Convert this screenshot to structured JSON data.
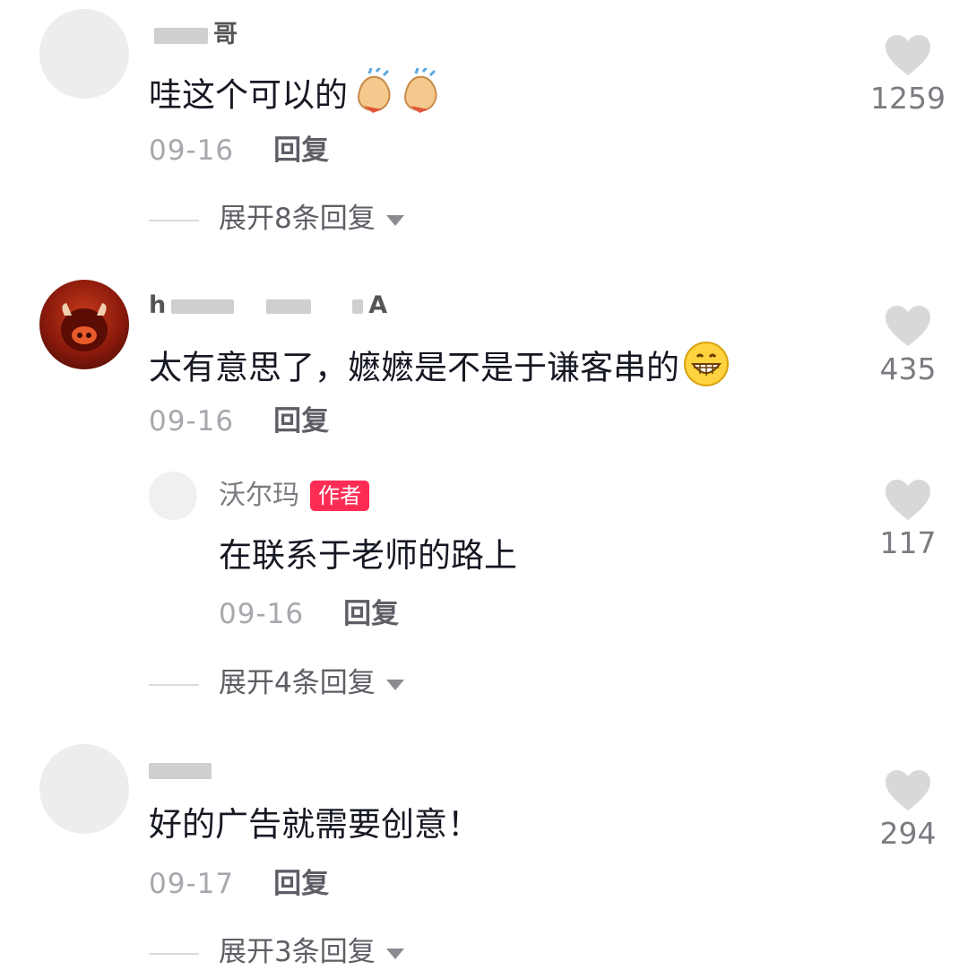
{
  "comments": [
    {
      "username_visible": "哥",
      "text": "哇这个可以的",
      "emoji": "clapping-hands",
      "date": "09-16",
      "reply_label": "回复",
      "likes": "1259",
      "expand_label": "展开8条回复"
    },
    {
      "username_visible": "A",
      "text": "太有意思了，嬷嬷是不是于谦客串的",
      "emoji": "grinning-face",
      "date": "09-16",
      "reply_label": "回复",
      "likes": "435",
      "reply": {
        "username": "沃尔玛",
        "badge": "作者",
        "text": "在联系于老师的路上",
        "date": "09-16",
        "reply_label": "回复",
        "likes": "117"
      },
      "expand_label": "展开4条回复"
    },
    {
      "username_visible": "",
      "text": "好的广告就需要创意！",
      "date": "09-17",
      "reply_label": "回复",
      "likes": "294",
      "expand_label": "展开3条回复"
    }
  ],
  "colors": {
    "badge": "#fe2c55",
    "heart": "#d8d8d8",
    "muted_text": "#a7a8ad"
  }
}
